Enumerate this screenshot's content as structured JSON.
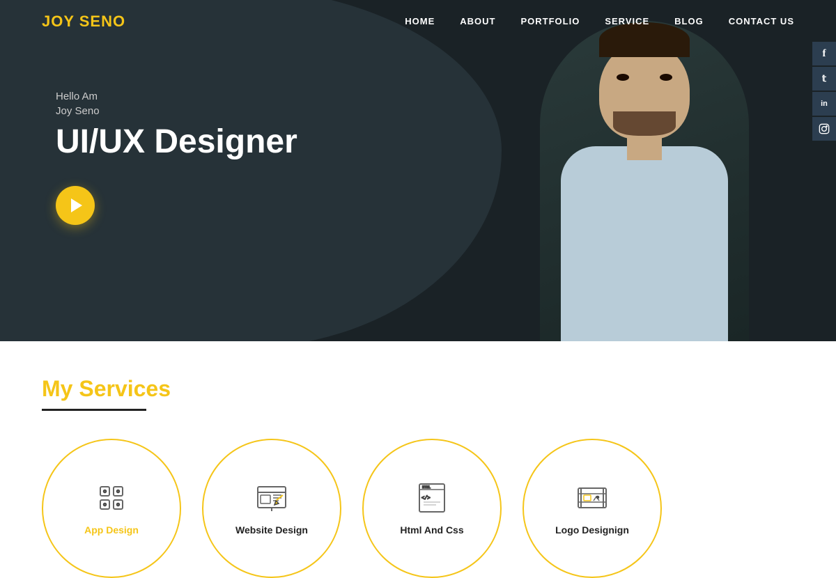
{
  "logo": {
    "first": "JOY",
    "last": "SENO"
  },
  "nav": {
    "items": [
      {
        "label": "HOME",
        "id": "home"
      },
      {
        "label": "ABOUT",
        "id": "about"
      },
      {
        "label": "PORTFOLIO",
        "id": "portfolio"
      },
      {
        "label": "SERVICE",
        "id": "service"
      },
      {
        "label": "BLOG",
        "id": "blog"
      },
      {
        "label": "CONTACT US",
        "id": "contact"
      }
    ]
  },
  "hero": {
    "greeting": "Hello Am",
    "name": "Joy Seno",
    "title": "UI/UX Designer"
  },
  "social": {
    "items": [
      {
        "label": "f",
        "id": "facebook",
        "name": "facebook-icon"
      },
      {
        "label": "t",
        "id": "twitter",
        "name": "twitter-icon"
      },
      {
        "label": "in",
        "id": "linkedin",
        "name": "linkedin-icon"
      },
      {
        "label": "ig",
        "id": "instagram",
        "name": "instagram-icon"
      }
    ]
  },
  "services": {
    "heading_highlight": "My",
    "heading_rest": " Services",
    "items": [
      {
        "label": "App Design",
        "active": true,
        "icon": "app-design"
      },
      {
        "label": "Website Design",
        "active": false,
        "icon": "website-design"
      },
      {
        "label": "Html And Css",
        "active": false,
        "icon": "html-css"
      },
      {
        "label": "Logo Designign",
        "active": false,
        "icon": "logo-design"
      }
    ]
  }
}
